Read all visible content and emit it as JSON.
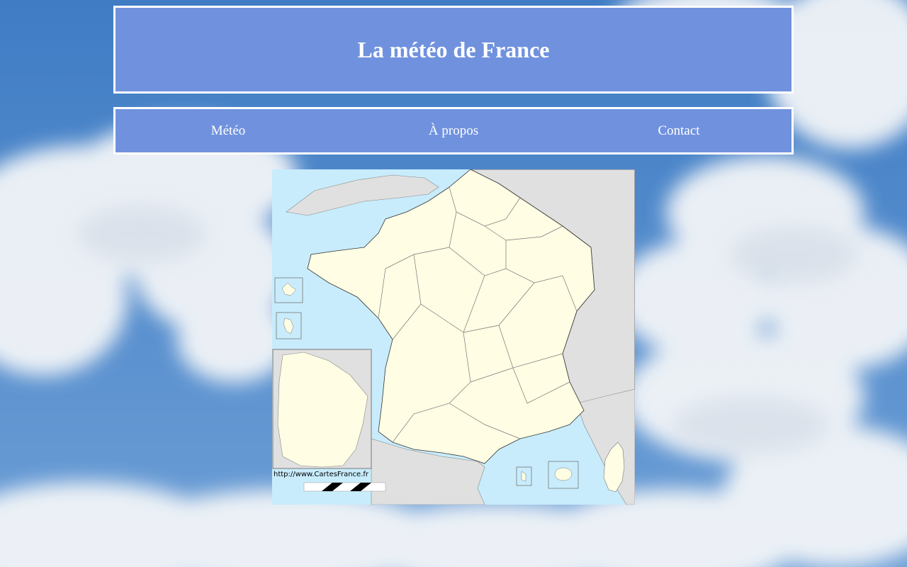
{
  "header": {
    "title": "La météo de France"
  },
  "nav": {
    "items": [
      {
        "label": "Météo"
      },
      {
        "label": "À propos"
      },
      {
        "label": "Contact"
      }
    ]
  },
  "map": {
    "credit": "http://www.CartesFrance.fr"
  },
  "colors": {
    "banner": "#7092de",
    "sea": "#c8ecfc",
    "land_france": "#fffde4",
    "land_other": "#e0e0e0",
    "sky": "#4a86cc"
  }
}
